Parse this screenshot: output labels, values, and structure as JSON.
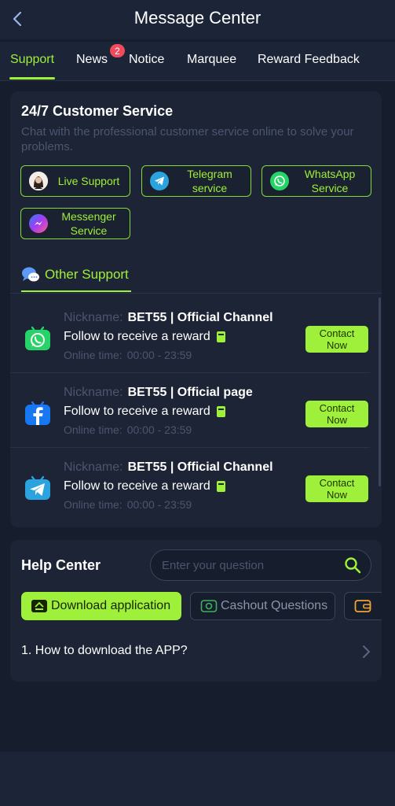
{
  "header": {
    "title": "Message Center",
    "back_icon": "chevron-left-icon"
  },
  "tabs": [
    {
      "label": "Support",
      "active": true
    },
    {
      "label": "News",
      "badge": "2"
    },
    {
      "label": "Notice"
    },
    {
      "label": "Marquee"
    },
    {
      "label": "Reward Feedback"
    }
  ],
  "customer_service": {
    "title": "24/7 Customer Service",
    "description": "Chat with the professional customer service online to solve your problems.",
    "services": [
      {
        "label": "Live Support",
        "icon": "agent-avatar-icon"
      },
      {
        "label": "Telegram service",
        "icon": "telegram-icon"
      },
      {
        "label": "WhatsApp Service",
        "icon": "whatsapp-icon"
      },
      {
        "label": "Messenger Service",
        "icon": "messenger-icon"
      }
    ]
  },
  "other_support": {
    "title": "Other Support",
    "rows": [
      {
        "nickname_label": "Nickname:",
        "nickname": "BET55 | Official Channel",
        "follow": "Follow to receive a reward",
        "online_label": "Online time:",
        "online": "00:00 - 23:59",
        "contact": "Contact Now",
        "icon": "whatsapp-tv-icon"
      },
      {
        "nickname_label": "Nickname:",
        "nickname": "BET55 | Official page",
        "follow": "Follow to receive a reward",
        "online_label": "Online time:",
        "online": "00:00 - 23:59",
        "contact": "Contact Now",
        "icon": "facebook-tv-icon"
      },
      {
        "nickname_label": "Nickname:",
        "nickname": "BET55 | Official Channel",
        "follow": "Follow to receive a reward",
        "online_label": "Online time:",
        "online": "00:00 - 23:59",
        "contact": "Contact Now",
        "icon": "telegram-tv-icon"
      }
    ]
  },
  "help_center": {
    "title": "Help Center",
    "search_placeholder": "Enter your question",
    "categories": [
      {
        "label": "Download application",
        "active": true,
        "icon": "download-app-icon"
      },
      {
        "label": "Cashout Questions",
        "active": false,
        "icon": "cashout-icon"
      },
      {
        "label": "",
        "active": false,
        "icon": "wallet-icon"
      }
    ],
    "faq": [
      {
        "text": "1. How to download the APP?"
      }
    ]
  },
  "colors": {
    "accent": "#9ef03a",
    "background": "#161d2d",
    "card": "#1d2436",
    "badge": "#ef4b5c"
  }
}
